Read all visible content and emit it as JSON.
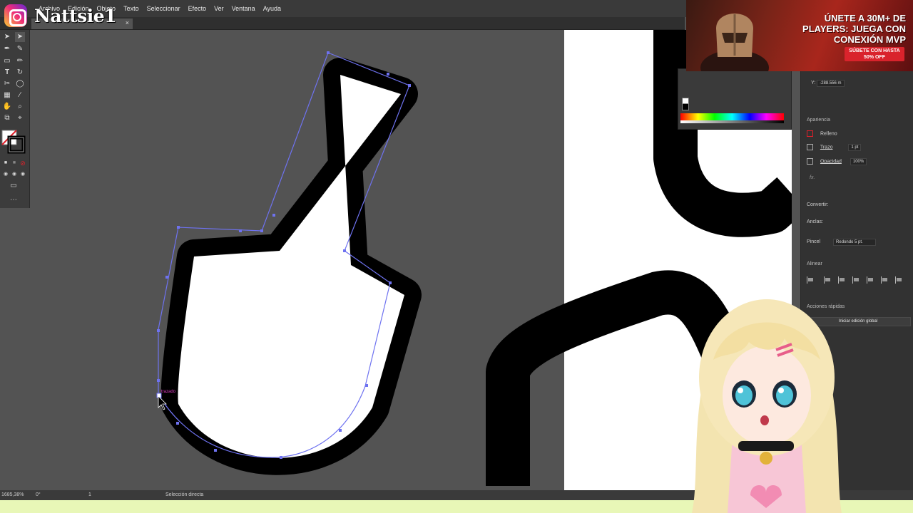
{
  "menu": {
    "items": [
      "Archivo",
      "Edición",
      "Objeto",
      "Texto",
      "Seleccionar",
      "Efecto",
      "Ver",
      "Ventana",
      "Ayuda"
    ]
  },
  "document_tab": {
    "close_icon": "×"
  },
  "overlay": {
    "handle": "Nattsie1",
    "logo_icon": "instagram-icon"
  },
  "canvas": {
    "anchor_label": "trazado",
    "colors": {
      "stroke": "#000000",
      "path_highlight": "#6e72f0",
      "artboard": "#ffffff",
      "pasteboard": "#535353"
    }
  },
  "status": {
    "zoom": "1685,38%",
    "rotation": "0°",
    "artboard_number": "1",
    "tool_name": "Selección directa"
  },
  "transform": {
    "y_label": "Y:",
    "y_value": "-288.556 m"
  },
  "appearance": {
    "section": "Apariencia",
    "fill_label": "Relleno",
    "stroke_label": "Trazo",
    "stroke_weight": "1 pt",
    "opacity_label": "Opacidad",
    "opacity_value": "100%",
    "fx_label": "fx."
  },
  "anchor_tools": {
    "convert_label": "Convertir:",
    "handles_label": "Asas:",
    "anchors_label": "Anclas:",
    "brush_label": "Pincel",
    "brush_value": "Redondo 5 pt."
  },
  "align": {
    "section": "Alinear"
  },
  "quick_actions": {
    "section": "Acciones rápidas",
    "global_edit_button": "Iniciar edición global"
  },
  "ad": {
    "headline": "ÚNETE A 30M+ DE PLAYERS: JUEGA CON CONEXIÓN MVP",
    "cta": "SÚBETE CON HASTA 50% OFF"
  }
}
